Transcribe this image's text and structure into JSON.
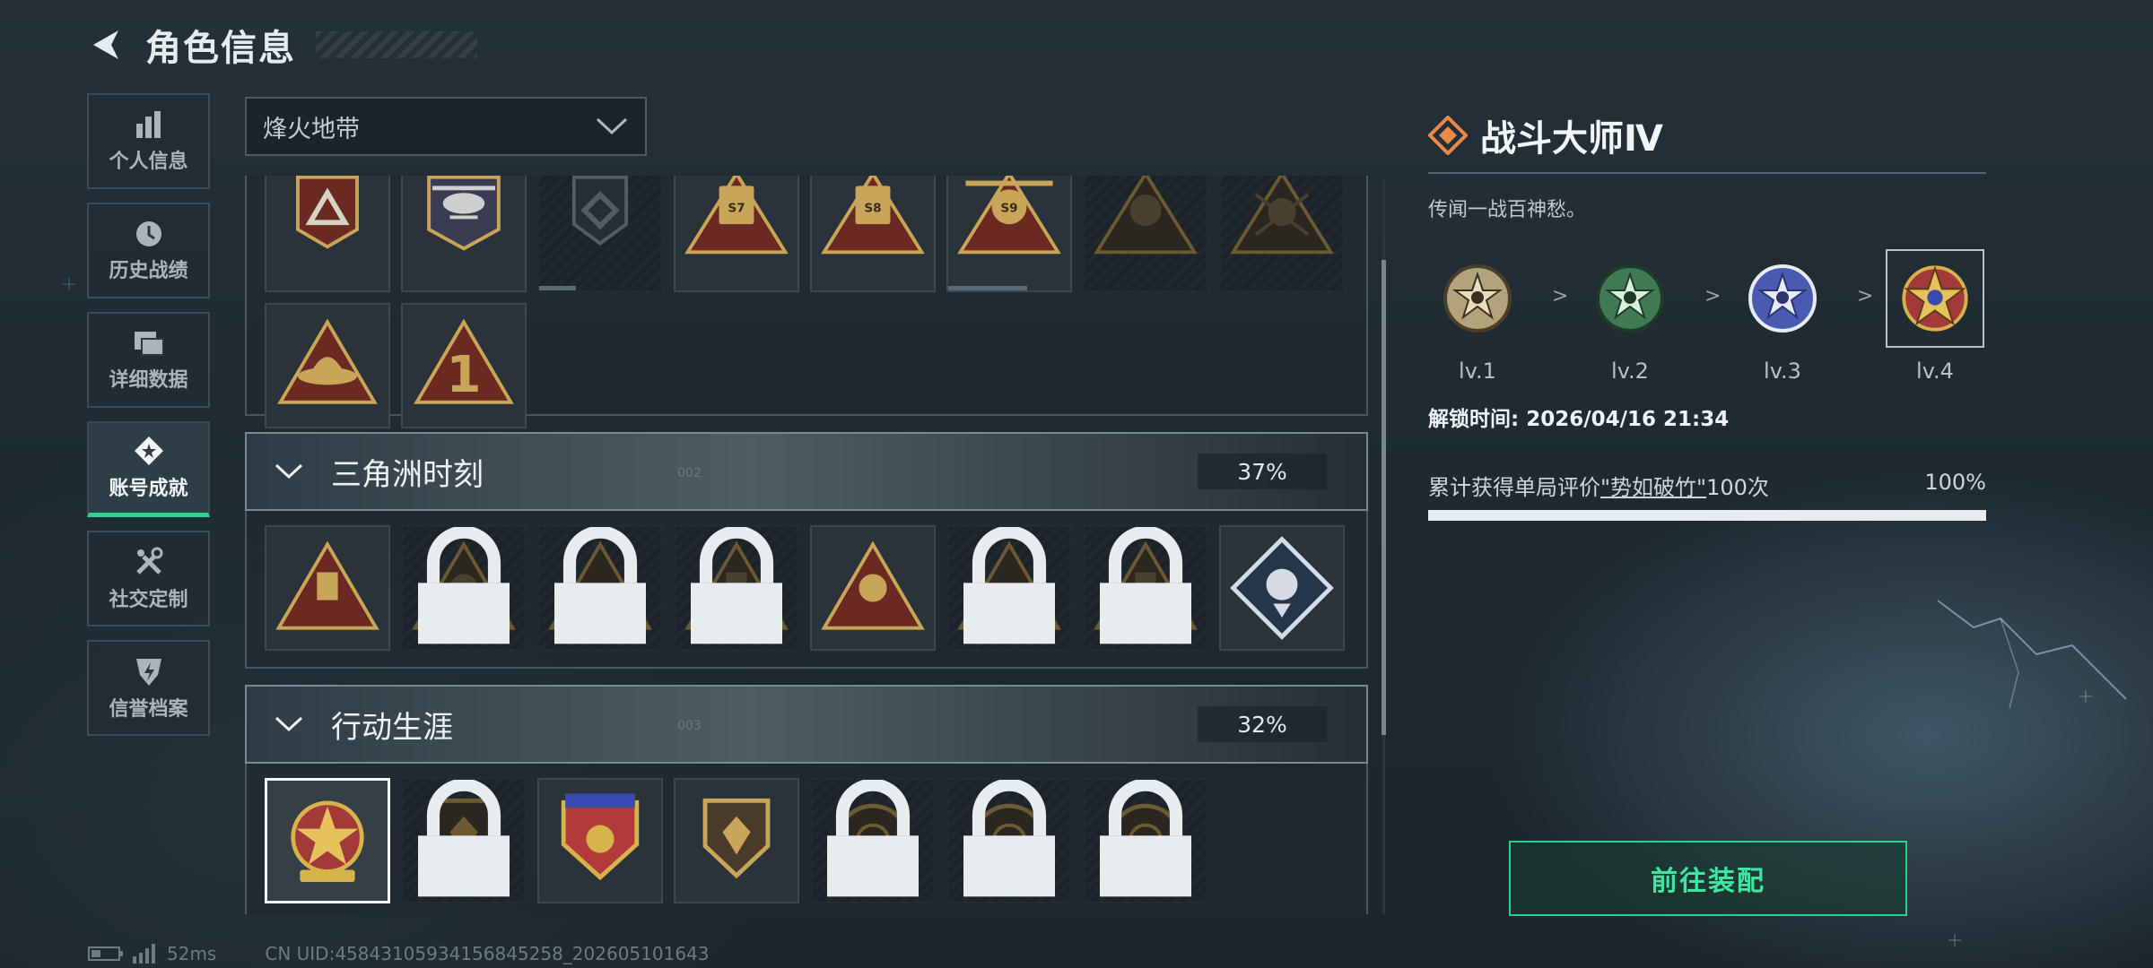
{
  "header": {
    "title": "角色信息"
  },
  "sidebar": {
    "items": [
      {
        "label": "个人信息",
        "icon": "bar-chart-icon"
      },
      {
        "label": "历史战绩",
        "icon": "clock-icon"
      },
      {
        "label": "详细数据",
        "icon": "folder-icon"
      },
      {
        "label": "账号成就",
        "icon": "badge-icon",
        "active": true
      },
      {
        "label": "社交定制",
        "icon": "tools-icon"
      },
      {
        "label": "信誉档案",
        "icon": "shield-icon"
      }
    ]
  },
  "mode_select": {
    "value": "烽火地带"
  },
  "top_group": {
    "row1": [
      {
        "text": "",
        "locked": false
      },
      {
        "text": "",
        "locked": false
      },
      {
        "text": "",
        "locked": false,
        "progress": 0.3
      },
      {
        "text": "S7",
        "locked": false
      },
      {
        "text": "S8",
        "locked": false
      },
      {
        "text": "S9",
        "locked": false,
        "progress": 0.65
      },
      {
        "text": "",
        "locked": false
      },
      {
        "text": "",
        "locked": false
      }
    ],
    "row2": [
      {
        "text": "",
        "locked": false
      },
      {
        "text": "1",
        "locked": false
      }
    ]
  },
  "categories": [
    {
      "name": "三角洲时刻",
      "percent": "37%",
      "deco": "002",
      "locked": [
        false,
        true,
        true,
        true,
        false,
        true,
        true,
        false
      ]
    },
    {
      "name": "行动生涯",
      "percent": "32%",
      "deco": "003",
      "locked": [
        false,
        true,
        false,
        false,
        true,
        true,
        true
      ]
    }
  ],
  "detail": {
    "title": "战斗大师Ⅳ",
    "description": "传闻一战百神愁。",
    "levels": [
      "lv.1",
      "lv.2",
      "lv.3",
      "lv.4"
    ],
    "separator": ">",
    "unlock_time": "解锁时间: 2026/04/16 21:34",
    "task_prefix": "累计获得单局评价",
    "task_highlight": "\"势如破竹\"",
    "task_suffix": "100次",
    "task_percent": "100%",
    "task_progress": 1.0,
    "equip_label": "前往装配"
  },
  "status": {
    "ping": "52ms",
    "uid": "CN UID:45843105934156845258_202605101643"
  },
  "colors": {
    "accent": "#2ed38f",
    "gold": "#c9a55a",
    "panel_border": "#4a5760"
  }
}
